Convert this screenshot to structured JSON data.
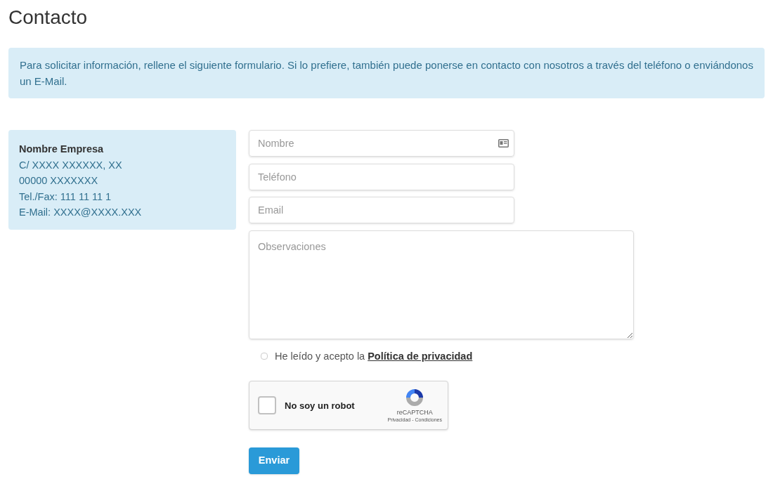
{
  "title": "Contacto",
  "notice": "Para solicitar información, rellene el siguiente formulario. Si lo prefiere, también puede ponerse en contacto con nosotros a través del teléfono o enviándonos un E-Mail.",
  "company": {
    "name": "Nombre Empresa",
    "lines": [
      "C/ XXXX XXXXXX, XX",
      "00000 XXXXXXX",
      "Tel./Fax: 111 11 11 1",
      "E-Mail: XXXX@XXXX.XXX"
    ]
  },
  "fields": [
    {
      "placeholder": "Nombre",
      "kind": "card"
    },
    {
      "placeholder": "Teléfono",
      "kind": "plain"
    },
    {
      "placeholder": "Email",
      "kind": "plain"
    }
  ],
  "textarea": {
    "placeholder": "Observaciones"
  },
  "privacy": {
    "checked": false,
    "text": "He leído y acepto la",
    "link": "Política de privacidad"
  },
  "captcha": {
    "checked": false,
    "label": "No soy un robot",
    "brand": "reCAPTCHA",
    "footer": "Privacidad - Condiciones"
  },
  "submit": "Enviar"
}
